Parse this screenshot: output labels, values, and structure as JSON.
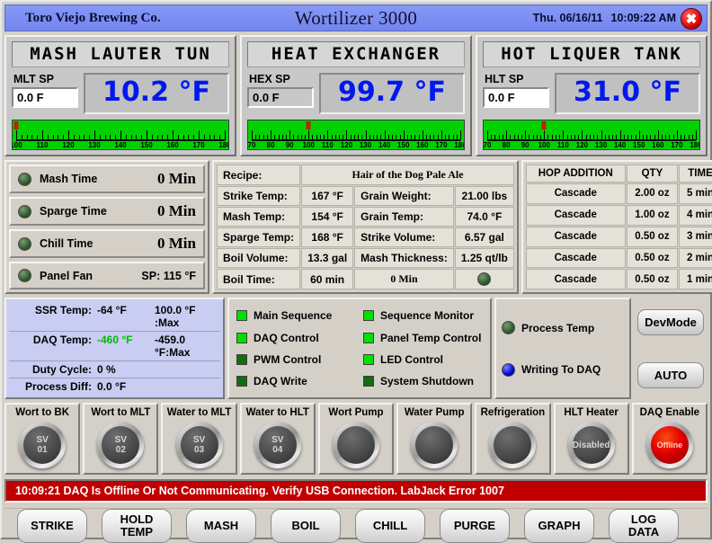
{
  "titlebar": {
    "company": "Toro Viejo Brewing Co.",
    "app_title": "Wortilizer 3000",
    "date": "Thu. 06/16/11",
    "time": "10:09:22 AM",
    "close_icon": "close-icon",
    "bg_color": "#7b8ef5"
  },
  "vessels": [
    {
      "name": "MASH LAUTER TUN",
      "sp_label": "MLT SP",
      "sp_value": "0.0 F",
      "sp_white": true,
      "temp": "10.2 °F",
      "gauge": {
        "min": 100,
        "max": 180,
        "step": 10,
        "pointer": 100,
        "labels": [
          "100",
          "110",
          "120",
          "130",
          "140",
          "150",
          "160",
          "170",
          "180"
        ]
      }
    },
    {
      "name": "HEAT EXCHANGER",
      "sp_label": "HEX SP",
      "sp_value": "0.0 F",
      "sp_white": false,
      "temp": "99.7 °F",
      "gauge": {
        "min": 70,
        "max": 180,
        "step": 10,
        "pointer": 99.7,
        "labels": [
          "70",
          "80",
          "90",
          "100",
          "110",
          "120",
          "130",
          "140",
          "150",
          "160",
          "170",
          "180"
        ]
      }
    },
    {
      "name": "HOT LIQUER TANK",
      "sp_label": "HLT SP",
      "sp_value": "0.0 F",
      "sp_white": true,
      "temp": "31.0 °F",
      "gauge": {
        "min": 70,
        "max": 180,
        "step": 10,
        "pointer": 100,
        "labels": [
          "70",
          "80",
          "90",
          "100",
          "110",
          "120",
          "130",
          "140",
          "150",
          "160",
          "170",
          "180"
        ]
      }
    }
  ],
  "timers": [
    {
      "label": "Mash Time",
      "value": "0 Min",
      "small": false
    },
    {
      "label": "Sparge Time",
      "value": "0 Min",
      "small": false
    },
    {
      "label": "Chill Time",
      "value": "0 Min",
      "small": false
    },
    {
      "label": "Panel Fan",
      "value": "SP: 115 °F",
      "small": true
    }
  ],
  "recipe": {
    "recipe_label": "Recipe:",
    "recipe_name": "Hair of the Dog Pale Ale",
    "rows": [
      {
        "l1": "Strike Temp:",
        "v1": "167 °F",
        "l2": "Grain Weight:",
        "v2": "21.00 lbs"
      },
      {
        "l1": "Mash Temp:",
        "v1": "154 °F",
        "l2": "Grain Temp:",
        "v2": "74.0 °F"
      },
      {
        "l1": "Sparge Temp:",
        "v1": "168 °F",
        "l2": "Strike Volume:",
        "v2": "6.57 gal"
      },
      {
        "l1": "Boil Volume:",
        "v1": "13.3 gal",
        "l2": "Mash Thickness:",
        "v2": "1.25 qt/lb"
      }
    ],
    "boil_time_label": "Boil Time:",
    "boil_time_value": "60 min",
    "boil_elapsed": "0 Min"
  },
  "hops": {
    "headers": [
      "HOP ADDITION",
      "QTY",
      "TIME"
    ],
    "rows": [
      {
        "name": "Cascade",
        "qty": "2.00 oz",
        "time": "5 min"
      },
      {
        "name": "Cascade",
        "qty": "1.00 oz",
        "time": "4 min"
      },
      {
        "name": "Cascade",
        "qty": "0.50 oz",
        "time": "3 min"
      },
      {
        "name": "Cascade",
        "qty": "0.50 oz",
        "time": "2 min"
      },
      {
        "name": "Cascade",
        "qty": "0.50 oz",
        "time": "1 min"
      }
    ]
  },
  "diagnostics": [
    {
      "key": "SSR Temp:",
      "v1": "-64 °F",
      "v2": "100.0 °F :Max",
      "green": false
    },
    {
      "key": "DAQ Temp:",
      "v1": "-460 °F",
      "v2": "-459.0 °F:Max",
      "green": true
    },
    {
      "key": "Duty Cycle:",
      "v1": "0 %",
      "v2": "",
      "green": false
    },
    {
      "key": "Process Diff:",
      "v1": "0.0 °F",
      "v2": "",
      "green": false
    }
  ],
  "leds": [
    {
      "label": "Main Sequence",
      "on": true
    },
    {
      "label": "Sequence Monitor",
      "on": true
    },
    {
      "label": "DAQ Control",
      "on": true
    },
    {
      "label": "Panel Temp Control",
      "on": true
    },
    {
      "label": "PWM Control",
      "on": false
    },
    {
      "label": "LED Control",
      "on": true
    },
    {
      "label": "DAQ Write",
      "on": false
    },
    {
      "label": "System Shutdown",
      "on": false
    }
  ],
  "flags": [
    {
      "label": "Process Temp",
      "color": "green"
    },
    {
      "label": "Writing To DAQ",
      "color": "blue"
    }
  ],
  "mode_buttons": [
    {
      "label": "DevMode"
    },
    {
      "label": "AUTO"
    }
  ],
  "devices": [
    {
      "name": "Wort to BK",
      "line1": "SV",
      "line2": "01",
      "state": "off"
    },
    {
      "name": "Wort to MLT",
      "line1": "SV",
      "line2": "02",
      "state": "off"
    },
    {
      "name": "Water to MLT",
      "line1": "SV",
      "line2": "03",
      "state": "off"
    },
    {
      "name": "Water to HLT",
      "line1": "SV",
      "line2": "04",
      "state": "off"
    },
    {
      "name": "Wort Pump",
      "line1": "",
      "line2": "",
      "state": "off"
    },
    {
      "name": "Water Pump",
      "line1": "",
      "line2": "",
      "state": "off"
    },
    {
      "name": "Refrigeration",
      "line1": "",
      "line2": "",
      "state": "off"
    },
    {
      "name": "HLT Heater",
      "line1": "Disabled",
      "line2": "",
      "state": "off"
    },
    {
      "name": "DAQ Enable",
      "line1": "Offline",
      "line2": "",
      "state": "red"
    }
  ],
  "alarm": {
    "message": "10:09:21 DAQ Is Offline Or Not Communicating. Verify USB Connection. LabJack Error 1007",
    "color": "#c00000"
  },
  "bottom_buttons": [
    {
      "label": "STRIKE"
    },
    {
      "label": "HOLD\nTEMP"
    },
    {
      "label": "MASH"
    },
    {
      "label": "BOIL"
    },
    {
      "label": "CHILL"
    },
    {
      "label": "PURGE"
    },
    {
      "label": "GRAPH"
    },
    {
      "label": "LOG\nDATA"
    }
  ]
}
